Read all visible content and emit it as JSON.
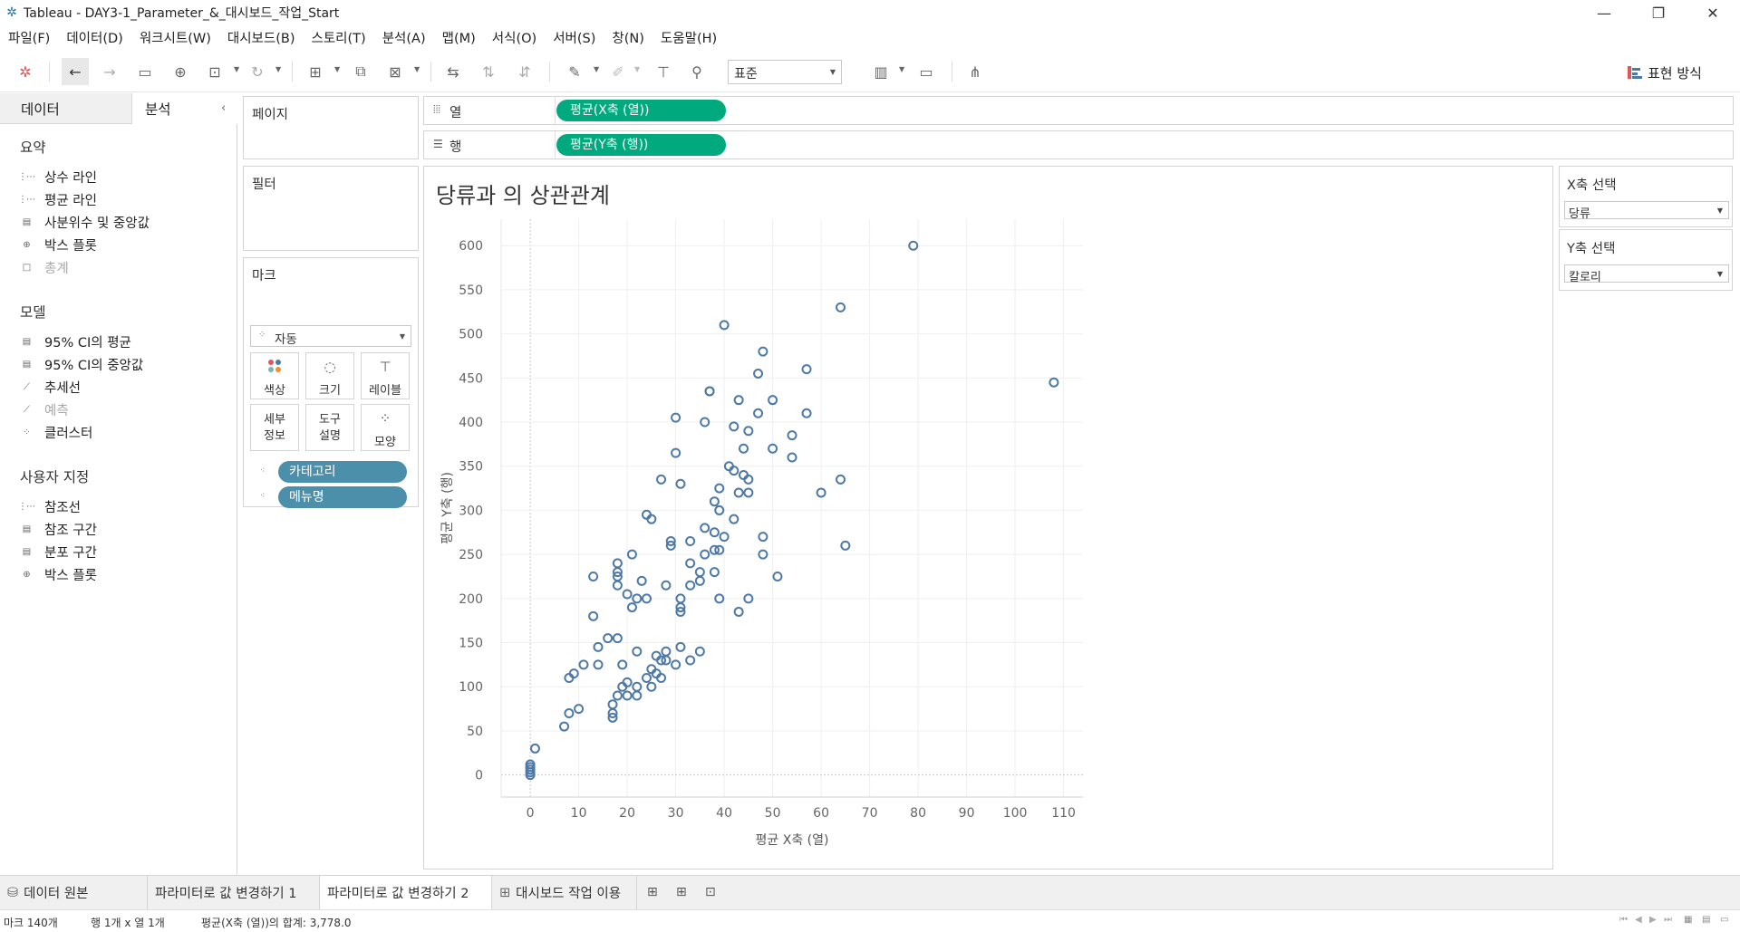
{
  "window": {
    "title": "Tableau - DAY3-1_Parameter_&_대시보드_작업_Start",
    "minimize": "—",
    "maximize": "❐",
    "close": "✕"
  },
  "menu": [
    "파일(F)",
    "데이터(D)",
    "워크시트(W)",
    "대시보드(B)",
    "스토리(T)",
    "분석(A)",
    "맵(M)",
    "서식(O)",
    "서버(S)",
    "창(N)",
    "도움말(H)"
  ],
  "toolbar": {
    "fit_value": "표준",
    "show_me_label": "표현 방식",
    "icons": [
      "tableau-logo-icon",
      "undo-icon",
      "redo-icon",
      "save-icon",
      "new-datasource-icon",
      "pause-update-icon",
      "refresh-icon",
      "new-worksheet-icon",
      "duplicate-icon",
      "clear-sheet-icon",
      "swap-axes-icon",
      "sort-ascending-icon",
      "sort-descending-icon",
      "highlight-icon",
      "group-icon",
      "label-icon",
      "pin-icon",
      "chart-view-icon",
      "presentation-icon",
      "share-icon"
    ]
  },
  "left_panel": {
    "tab_data": "데이터",
    "tab_analysis": "분석",
    "sections": [
      {
        "title": "요약",
        "items": [
          {
            "label": "상수 라인",
            "icon": "constant-line-icon",
            "enabled": true
          },
          {
            "label": "평균 라인",
            "icon": "average-line-icon",
            "enabled": true
          },
          {
            "label": "사분위수 및 중앙값",
            "icon": "quartile-icon",
            "enabled": true
          },
          {
            "label": "박스 플롯",
            "icon": "box-plot-icon",
            "enabled": true
          },
          {
            "label": "총계",
            "icon": "totals-icon",
            "enabled": false
          }
        ]
      },
      {
        "title": "모델",
        "items": [
          {
            "label": "95% CI의 평균",
            "icon": "ci-mean-icon",
            "enabled": true
          },
          {
            "label": "95% CI의 중앙값",
            "icon": "ci-median-icon",
            "enabled": true
          },
          {
            "label": "추세선",
            "icon": "trend-line-icon",
            "enabled": true
          },
          {
            "label": "예측",
            "icon": "forecast-icon",
            "enabled": false
          },
          {
            "label": "클러스터",
            "icon": "cluster-icon",
            "enabled": true
          }
        ]
      },
      {
        "title": "사용자 지정",
        "items": [
          {
            "label": "참조선",
            "icon": "reference-line-icon",
            "enabled": true
          },
          {
            "label": "참조 구간",
            "icon": "reference-band-icon",
            "enabled": true
          },
          {
            "label": "분포 구간",
            "icon": "distribution-band-icon",
            "enabled": true
          },
          {
            "label": "박스 플롯",
            "icon": "box-plot-icon",
            "enabled": true
          }
        ]
      }
    ]
  },
  "cards": {
    "pages_title": "페이지",
    "filters_title": "필터",
    "marks_title": "마크",
    "marks_type": "자동",
    "mark_buttons": {
      "color": "색상",
      "size": "크기",
      "label": "레이블",
      "detail": "세부\n정보",
      "tooltip": "도구\n설명",
      "shape": "모양"
    },
    "detail_pills": [
      "카테고리",
      "메뉴명"
    ]
  },
  "shelves": {
    "columns_label": "열",
    "rows_label": "행",
    "columns_pill": "평균(X축 (열))",
    "rows_pill": "평균(Y축 (행))"
  },
  "sheet": {
    "title": "당류과 의 상관관계"
  },
  "parameters": [
    {
      "title": "X축 선택",
      "value": "당류"
    },
    {
      "title": "Y축 선택",
      "value": "칼로리"
    }
  ],
  "sheet_tabs": {
    "datasource": "데이터 원본",
    "tabs": [
      "파라미터로 값 변경하기 1",
      "파라미터로 값 변경하기 2",
      "대시보드 작업 이용"
    ],
    "active_index": 1
  },
  "status": {
    "marks": "마크 140개",
    "dims": "행 1개 x 열 1개",
    "sum": "평균(X축 (열))의 합계: 3,778.0"
  },
  "chart_data": {
    "type": "scatter",
    "title": "당류과 의 상관관계",
    "xlabel": "평균 X축 (열)",
    "ylabel": "평균 Y축 (행)",
    "xlim": [
      -6,
      114
    ],
    "ylim": [
      -25,
      630
    ],
    "x_ticks": [
      0,
      10,
      20,
      30,
      40,
      50,
      60,
      70,
      80,
      90,
      100,
      110
    ],
    "y_ticks": [
      0,
      50,
      100,
      150,
      200,
      250,
      300,
      350,
      400,
      450,
      500,
      550,
      600
    ],
    "grid": true,
    "marker": "open-circle",
    "color": "#4e79a7",
    "points": [
      [
        0,
        0
      ],
      [
        0,
        3
      ],
      [
        0,
        6
      ],
      [
        0,
        9
      ],
      [
        0,
        12
      ],
      [
        1,
        30
      ],
      [
        7,
        55
      ],
      [
        8,
        70
      ],
      [
        8,
        110
      ],
      [
        9,
        115
      ],
      [
        10,
        75
      ],
      [
        11,
        125
      ],
      [
        13,
        180
      ],
      [
        13,
        225
      ],
      [
        14,
        125
      ],
      [
        14,
        145
      ],
      [
        16,
        155
      ],
      [
        17,
        65
      ],
      [
        17,
        70
      ],
      [
        17,
        80
      ],
      [
        18,
        90
      ],
      [
        18,
        155
      ],
      [
        18,
        215
      ],
      [
        18,
        225
      ],
      [
        18,
        230
      ],
      [
        18,
        240
      ],
      [
        19,
        100
      ],
      [
        19,
        125
      ],
      [
        20,
        90
      ],
      [
        20,
        105
      ],
      [
        20,
        205
      ],
      [
        21,
        190
      ],
      [
        21,
        250
      ],
      [
        22,
        100
      ],
      [
        22,
        90
      ],
      [
        22,
        140
      ],
      [
        22,
        200
      ],
      [
        23,
        220
      ],
      [
        24,
        110
      ],
      [
        24,
        200
      ],
      [
        24,
        295
      ],
      [
        25,
        100
      ],
      [
        25,
        120
      ],
      [
        25,
        290
      ],
      [
        26,
        135
      ],
      [
        26,
        115
      ],
      [
        27,
        110
      ],
      [
        27,
        130
      ],
      [
        27,
        335
      ],
      [
        28,
        140
      ],
      [
        28,
        130
      ],
      [
        28,
        215
      ],
      [
        29,
        260
      ],
      [
        29,
        265
      ],
      [
        30,
        125
      ],
      [
        30,
        365
      ],
      [
        30,
        405
      ],
      [
        31,
        145
      ],
      [
        31,
        185
      ],
      [
        31,
        190
      ],
      [
        31,
        200
      ],
      [
        31,
        330
      ],
      [
        33,
        130
      ],
      [
        33,
        240
      ],
      [
        33,
        265
      ],
      [
        33,
        215
      ],
      [
        35,
        140
      ],
      [
        35,
        220
      ],
      [
        35,
        230
      ],
      [
        36,
        250
      ],
      [
        36,
        280
      ],
      [
        36,
        400
      ],
      [
        37,
        435
      ],
      [
        37,
        435
      ],
      [
        38,
        230
      ],
      [
        38,
        255
      ],
      [
        38,
        275
      ],
      [
        38,
        310
      ],
      [
        39,
        200
      ],
      [
        39,
        255
      ],
      [
        39,
        300
      ],
      [
        39,
        325
      ],
      [
        40,
        270
      ],
      [
        40,
        510
      ],
      [
        41,
        350
      ],
      [
        42,
        290
      ],
      [
        42,
        395
      ],
      [
        42,
        345
      ],
      [
        43,
        185
      ],
      [
        43,
        320
      ],
      [
        43,
        425
      ],
      [
        44,
        340
      ],
      [
        44,
        370
      ],
      [
        45,
        200
      ],
      [
        45,
        320
      ],
      [
        45,
        335
      ],
      [
        45,
        390
      ],
      [
        47,
        410
      ],
      [
        47,
        455
      ],
      [
        48,
        250
      ],
      [
        48,
        270
      ],
      [
        48,
        480
      ],
      [
        50,
        370
      ],
      [
        50,
        425
      ],
      [
        51,
        225
      ],
      [
        54,
        360
      ],
      [
        54,
        385
      ],
      [
        57,
        410
      ],
      [
        57,
        460
      ],
      [
        60,
        320
      ],
      [
        64,
        335
      ],
      [
        64,
        530
      ],
      [
        65,
        260
      ],
      [
        79,
        600
      ],
      [
        108,
        445
      ]
    ]
  }
}
